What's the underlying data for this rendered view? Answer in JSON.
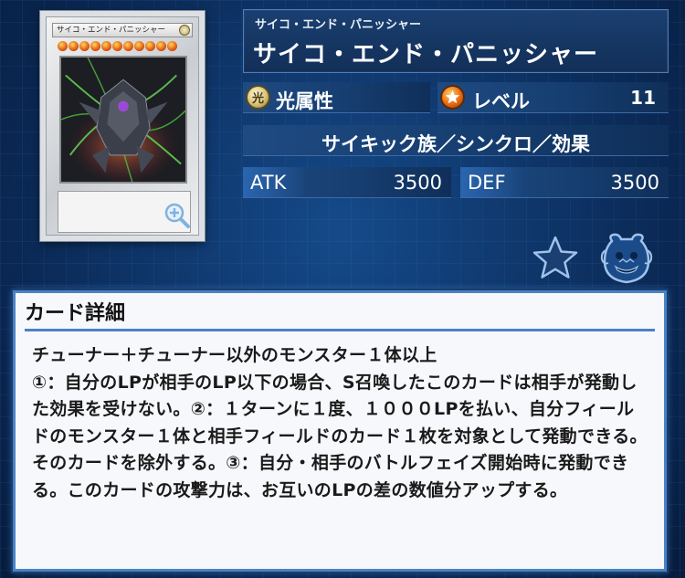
{
  "card": {
    "name_ruby": "サイコ・エンド・パニッシャー",
    "name": "サイコ・エンド・パニッシャー",
    "image_name": "サイコ・エンド・パニッシャー",
    "image_level_stars": 11,
    "attribute_icon_glyph": "光",
    "attribute": "光属性",
    "level_label": "レベル",
    "level": "11",
    "type_line": "サイキック族／シンクロ／効果",
    "atk_label": "ATK",
    "atk": "3500",
    "def_label": "DEF",
    "def": "3500"
  },
  "icons": {
    "zoom": "zoom-in-icon",
    "favorite": "star-icon",
    "deck": "pot-of-greed-icon",
    "level": "level-star-icon"
  },
  "detail": {
    "title": "カード詳細",
    "text": "チューナー＋チューナー以外のモンスター１体以上\n①：自分のLPが相手のLP以下の場合、S召喚したこのカードは相手が発動した効果を受けない。②：１ターンに１度、１０００LPを払い、自分フィールドのモンスター１体と相手フィールドのカード１枚を対象として発動できる。そのカードを除外する。③：自分・相手のバトルフェイズ開始時に発動できる。このカードの攻撃力は、お互いのLPの差の数値分アップする。"
  },
  "colors": {
    "background": "#0b2a57",
    "panel_border": "#4a82c4",
    "info_bar": "#1e4a82",
    "level_orange": "#e76a14"
  }
}
